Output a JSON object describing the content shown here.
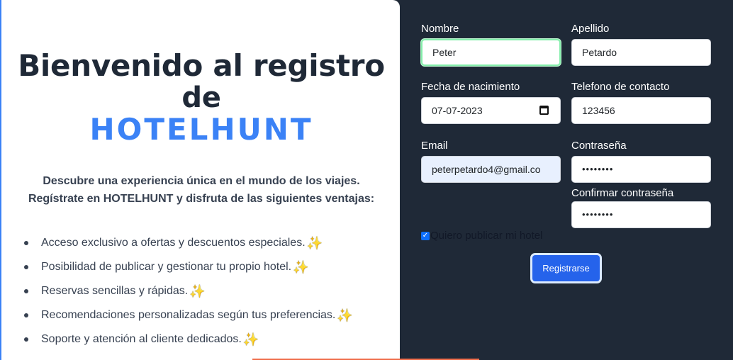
{
  "welcome": {
    "title_line1": "Bienvenido al registro",
    "title_line2": "de",
    "brand": "HOTELHUNT",
    "description_line1": "Descubre una experiencia única en el mundo de los viajes.",
    "description_line2": "Regístrate en HOTELHUNT y disfruta de las siguientes ventajas:",
    "benefits": [
      "Acceso exclusivo a ofertas y descuentos especiales.",
      "Posibilidad de publicar y gestionar tu propio hotel.",
      "Reservas sencillas y rápidas.",
      "Recomendaciones personalizadas según tus preferencias.",
      "Soporte y atención al cliente dedicados."
    ],
    "benefit_icon": "✨"
  },
  "form": {
    "nombre": {
      "label": "Nombre",
      "value": "Peter"
    },
    "apellido": {
      "label": "Apellido",
      "value": "Petardo"
    },
    "fecha": {
      "label": "Fecha de nacimiento",
      "value": "07-07-2023"
    },
    "telefono": {
      "label": "Telefono de contacto",
      "value": "123456"
    },
    "email": {
      "label": "Email",
      "value": "peterpetardo4@gmail.co"
    },
    "contrasena": {
      "label": "Contraseña",
      "value": "••••••••"
    },
    "confirmar": {
      "label": "Confirmar contraseña",
      "value": "••••••••"
    },
    "publicar": {
      "label": "Quiero publicar mi hotel",
      "checked": true
    },
    "submit_label": "Registrarse"
  },
  "colors": {
    "brand": "#3b82f6",
    "panel_dark": "#1f2937",
    "button": "#2563eb"
  }
}
